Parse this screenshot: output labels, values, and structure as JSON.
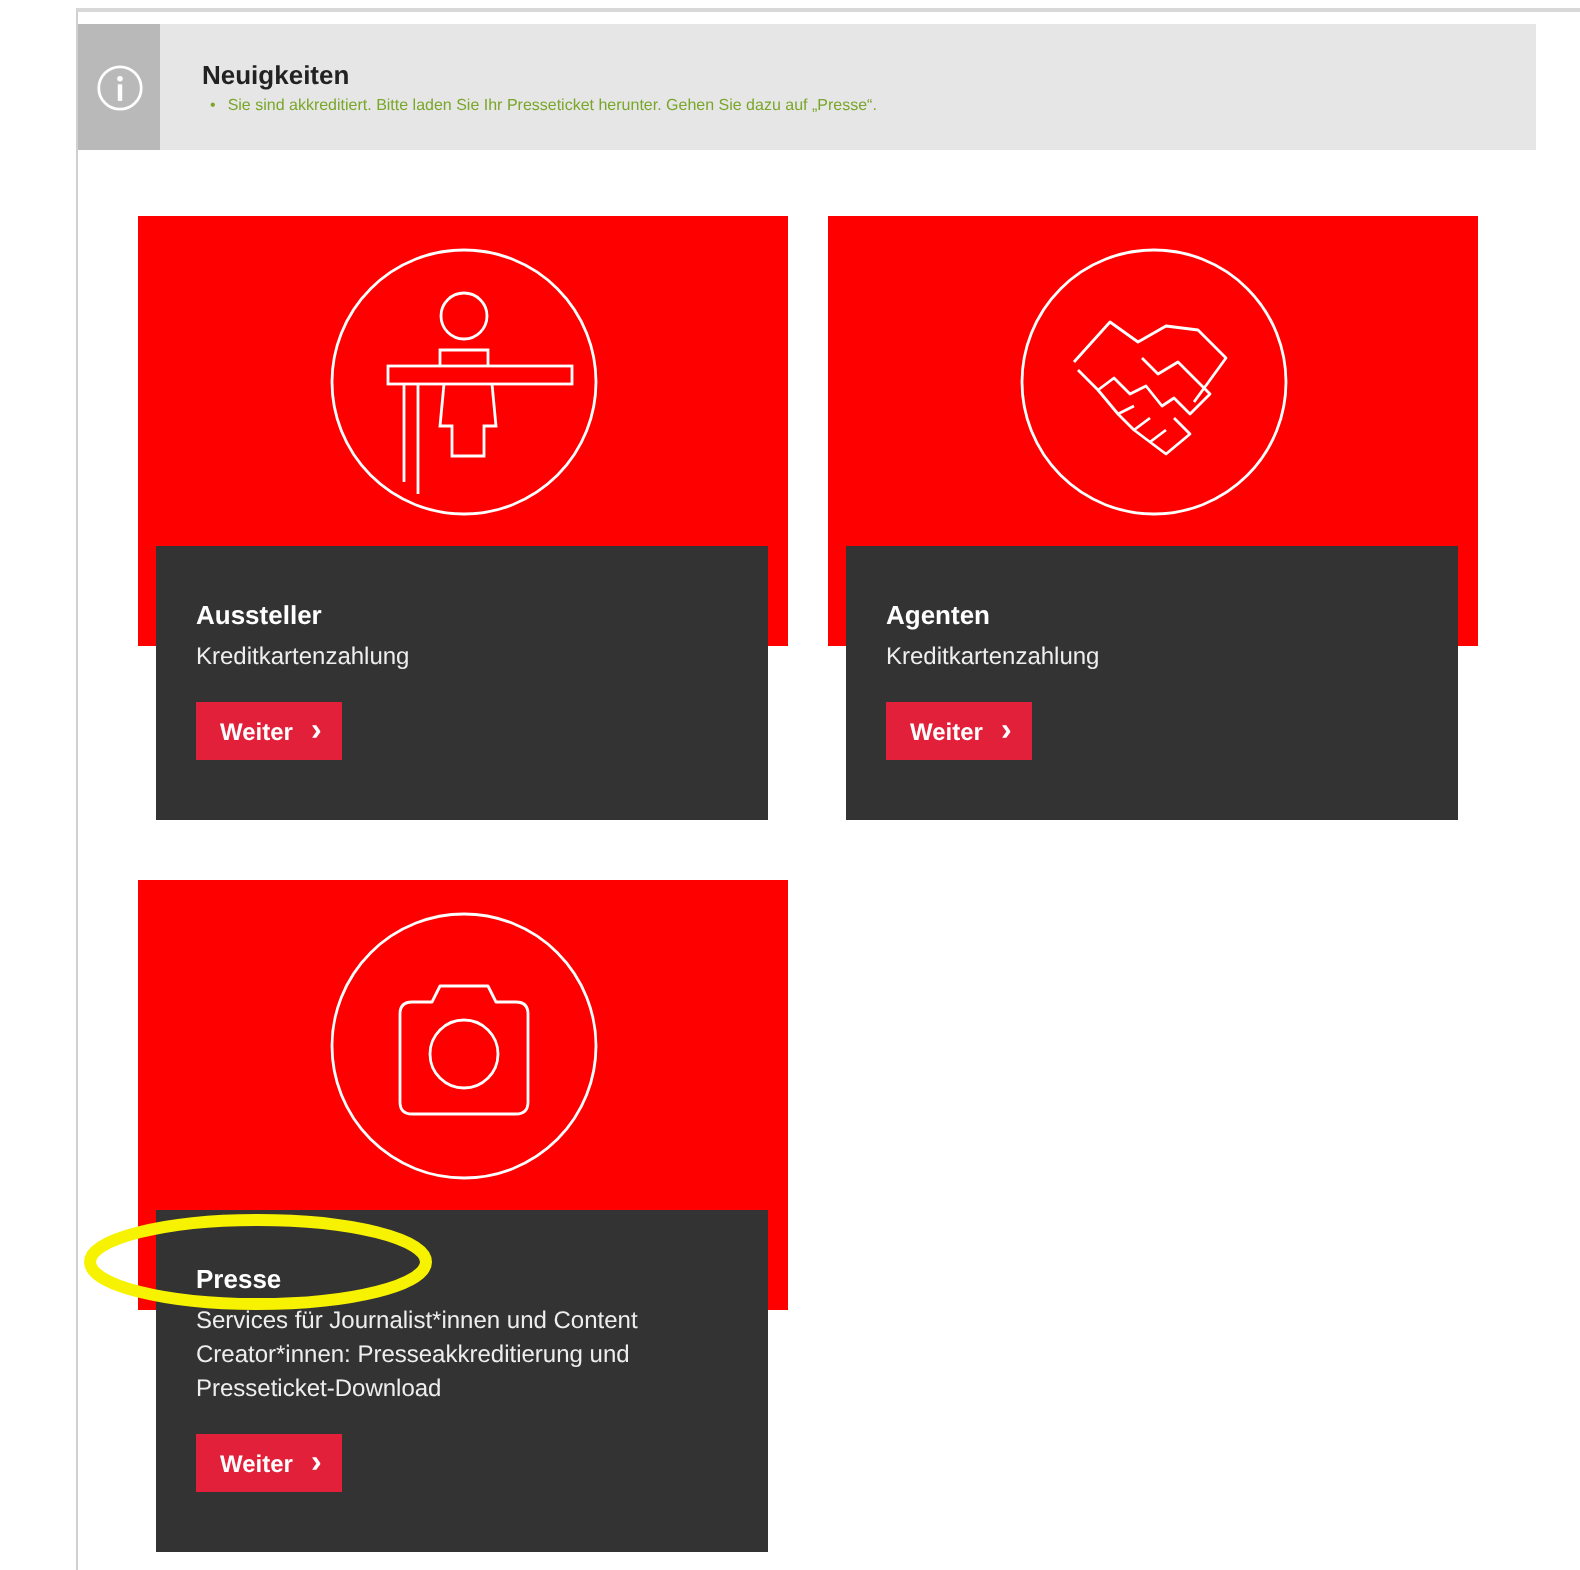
{
  "notice": {
    "title": "Neuigkeiten",
    "bullet": "•",
    "items": [
      "Sie sind akkreditiert. Bitte laden Sie Ihr Presseticket herunter. Gehen Sie dazu auf „Presse“."
    ]
  },
  "cards": [
    {
      "title": "Aussteller",
      "description": "Kreditkartenzahlung",
      "button": "Weiter",
      "button_icon": "›"
    },
    {
      "title": "Agenten",
      "description": "Kreditkartenzahlung",
      "button": "Weiter",
      "button_icon": "›"
    },
    {
      "title": "Presse",
      "description": "Services für Journalist*innen und Content Creator*innen: Presseakkreditierung und Presseticket-Download",
      "button": "Weiter",
      "button_icon": "›"
    }
  ],
  "annotations": [
    {
      "kind": "ellipse"
    }
  ]
}
